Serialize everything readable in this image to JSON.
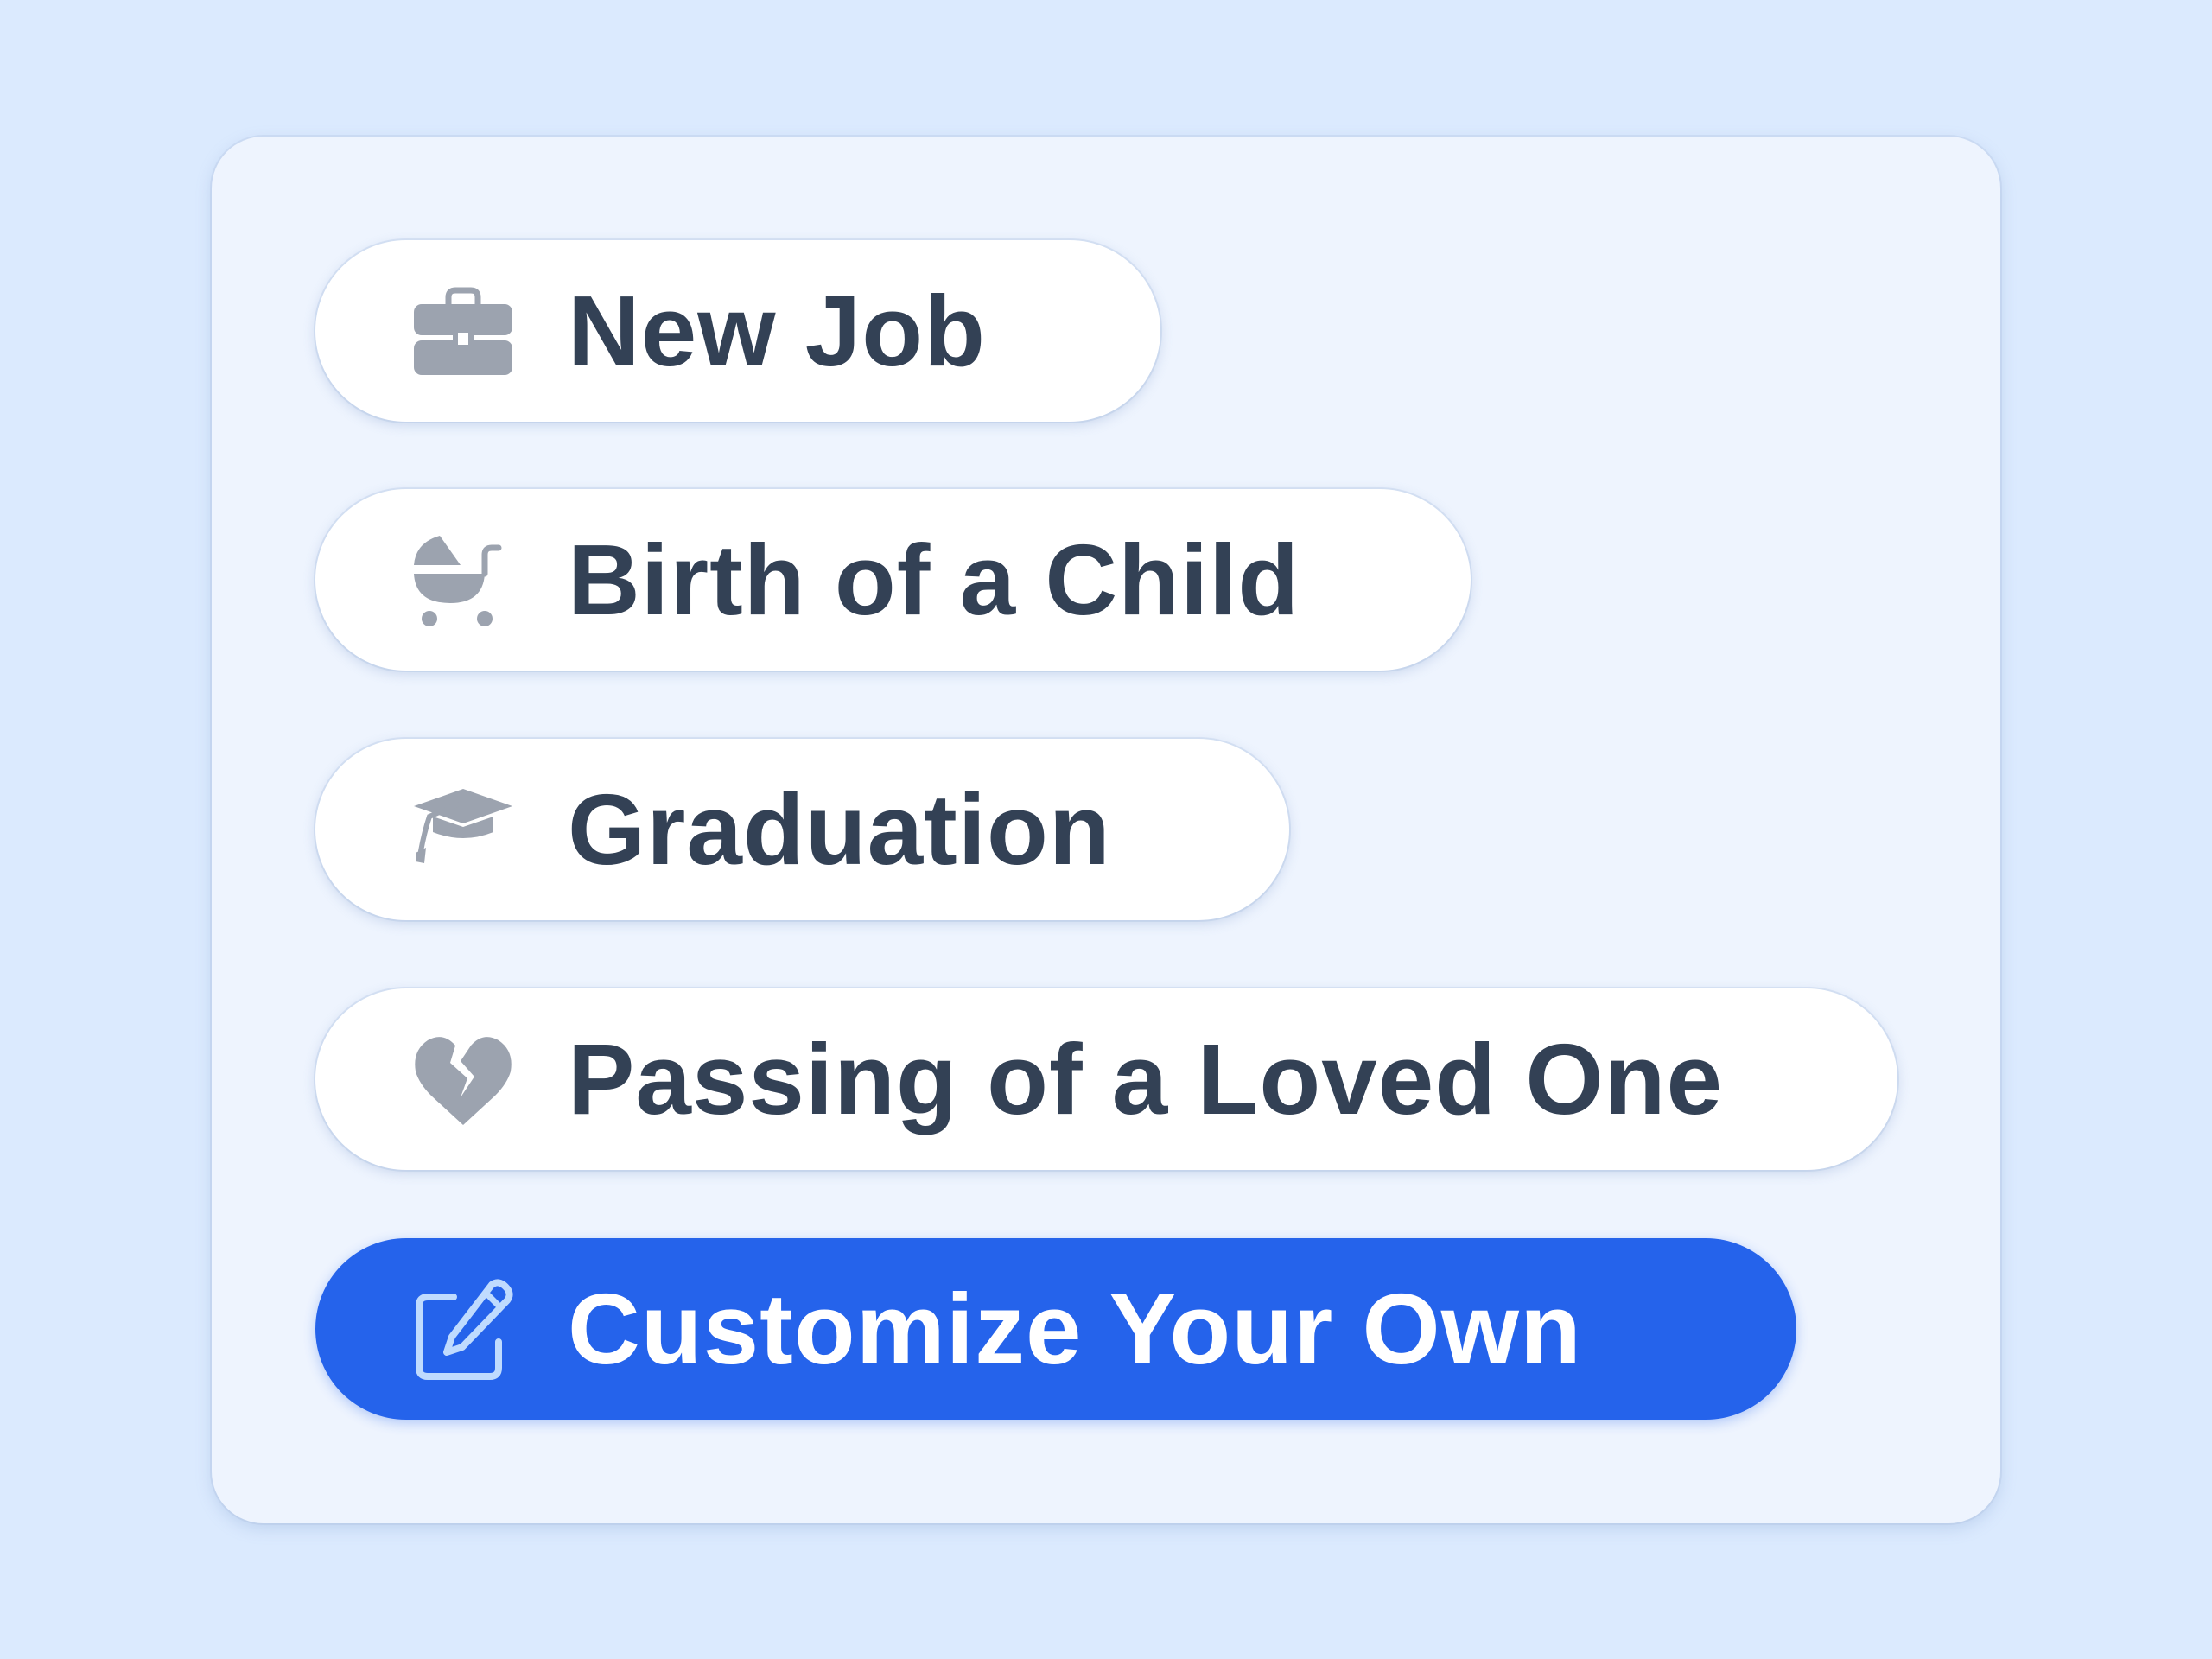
{
  "options": [
    {
      "label": "New Job",
      "icon": "briefcase-icon"
    },
    {
      "label": "Birth of a Child",
      "icon": "baby-carriage-icon"
    },
    {
      "label": "Graduation",
      "icon": "graduation-cap-icon"
    },
    {
      "label": "Passing of a Loved One",
      "icon": "broken-heart-icon"
    },
    {
      "label": "Customize Your Own",
      "icon": "edit-pencil-icon",
      "selected": true
    }
  ],
  "colors": {
    "background": "#dbeafe",
    "card": "#eef4fe",
    "pill": "#ffffff",
    "text": "#334155",
    "icon": "#9ca3af",
    "accent": "#2563eb"
  }
}
